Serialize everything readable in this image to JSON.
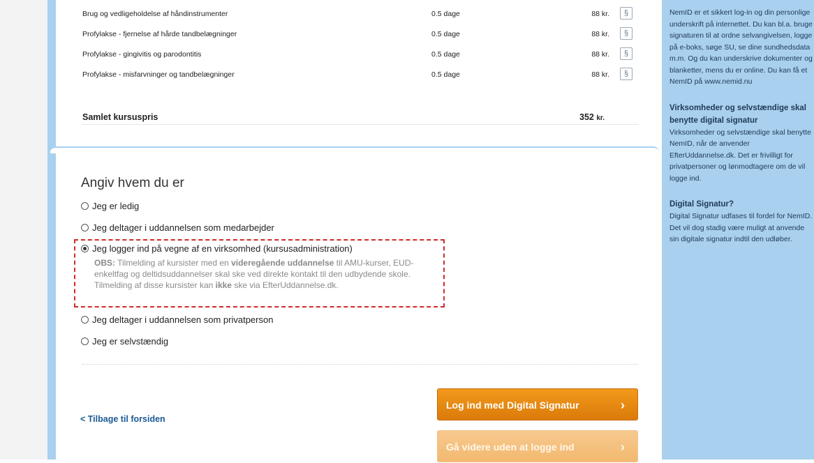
{
  "courses": [
    {
      "name": "Brug og vedligeholdelse af håndinstrumenter",
      "days": "0.5 dage",
      "price": "88 kr.",
      "icon": "§"
    },
    {
      "name": "Profylakse - fjernelse af hårde tandbelægninger",
      "days": "0.5 dage",
      "price": "88 kr.",
      "icon": "§"
    },
    {
      "name": "Profylakse - gingivitis og parodontitis",
      "days": "0.5 dage",
      "price": "88 kr.",
      "icon": "§"
    },
    {
      "name": "Profylakse - misfarvninger og tandbelægninger",
      "days": "0.5 dage",
      "price": "88 kr.",
      "icon": "§"
    }
  ],
  "total": {
    "label": "Samlet kursuspris",
    "amount": "352",
    "unit": "kr."
  },
  "who": {
    "title": "Angiv hvem du er",
    "options": [
      {
        "label": "Jeg er ledig",
        "checked": false
      },
      {
        "label": "Jeg deltager i uddannelsen som medarbejder",
        "checked": false
      },
      {
        "label": "Jeg logger ind på vegne af en virksomhed (kursusadministration)",
        "checked": true
      },
      {
        "label": "Jeg deltager i uddannelsen som privatperson",
        "checked": false
      },
      {
        "label": "Jeg er selvstændig",
        "checked": false
      }
    ],
    "obs": {
      "prefix": "OBS:",
      "t1": " Tilmelding af kursister med en ",
      "b1": "videregående uddannelse",
      "t2": " til AMU-kurser, EUD-enkeltfag og deltidsuddannelser skal ske ved direkte kontakt til den udbydende skole. Tilmelding af disse kursister kan ",
      "b2": "ikke",
      "t3": " ske via EfterUddannelse.dk."
    }
  },
  "back_link": "< Tilbage til forsiden",
  "buttons": {
    "login_signature": "Log ind med Digital Signatur",
    "continue_without": "Gå videre uden at logge ind",
    "chevron": "›"
  },
  "sidebar": {
    "intro": "NemID er et sikkert log-in og din personlige underskrift på internettet. Du kan bl.a. bruge signaturen til at ordne selvangivelsen, logge på e-boks, søge SU, se dine sundhedsdata m.m. Og du kan underskrive dokumenter og blanketter, mens du er online. Du kan få et NemID på",
    "link": "www.nemid.nu",
    "h1": "Virksomheder og selvstændige skal benytte digital signatur",
    "p1": "Virksomheder og selvstændige skal benytte NemID, når de anvender EfterUddannelse.dk. Det er frivilligt for privatpersoner og lønmodtagere om de vil logge ind.",
    "h2": "Digital Signatur?",
    "p2": "Digital Signatur udfases til fordel for NemID. Det vil dog stadig være muligt at anvende sin digitale signatur indtil den udløber."
  },
  "colors": {
    "accent": "#e8890f",
    "sidebar": "#a9d0ee",
    "highlight": "#d12a2a",
    "link": "#1a5a93"
  }
}
